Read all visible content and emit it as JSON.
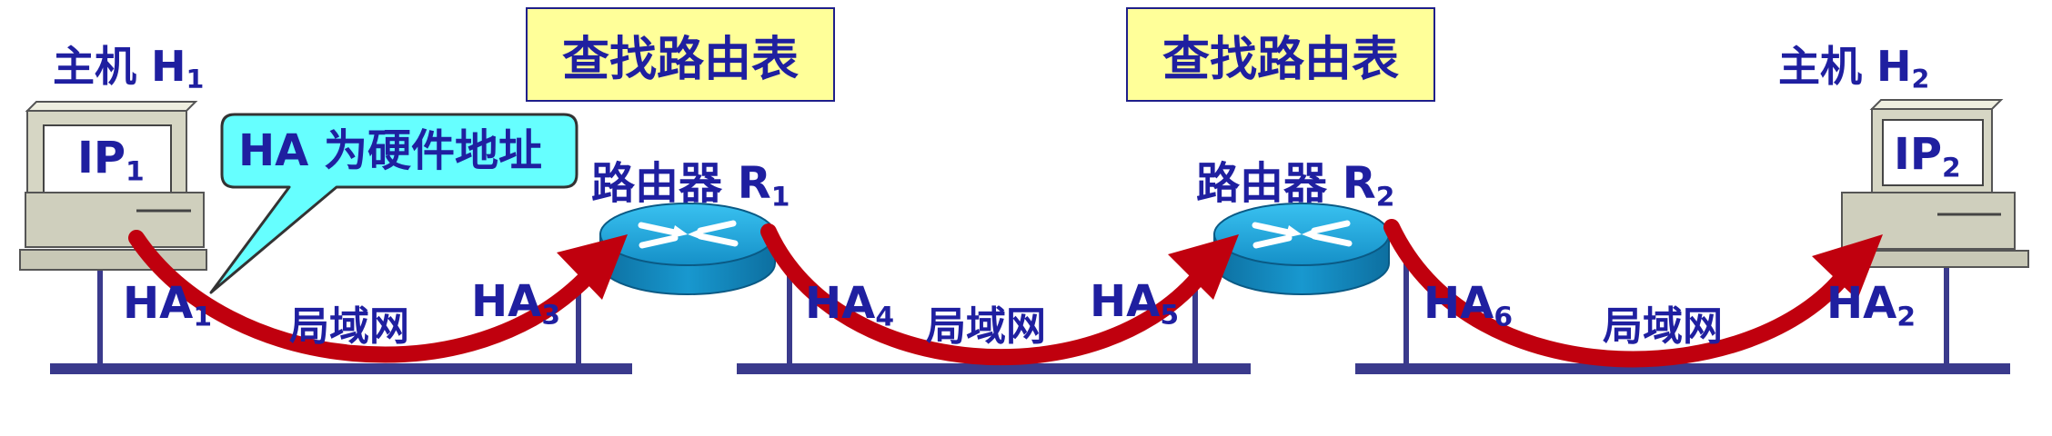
{
  "lookup_boxes": [
    {
      "label": "查找路由表"
    },
    {
      "label": "查找路由表"
    }
  ],
  "hosts": [
    {
      "label": "主机 H",
      "sub": "1",
      "screen_label": "IP",
      "screen_sub": "1"
    },
    {
      "label": "主机 H",
      "sub": "2",
      "screen_label": "IP",
      "screen_sub": "2"
    }
  ],
  "routers": [
    {
      "label": "路由器 R",
      "sub": "1"
    },
    {
      "label": "路由器 R",
      "sub": "2"
    }
  ],
  "callout": {
    "text": "HA 为硬件地址"
  },
  "lan_label": "局域网",
  "hardware_addresses": [
    {
      "label": "HA",
      "sub": "1"
    },
    {
      "label": "HA",
      "sub": "3"
    },
    {
      "label": "HA",
      "sub": "4"
    },
    {
      "label": "HA",
      "sub": "5"
    },
    {
      "label": "HA",
      "sub": "6"
    },
    {
      "label": "HA",
      "sub": "2"
    }
  ],
  "colors": {
    "text": "#1f1fa0",
    "box_fill": "#ffff99",
    "callout_fill": "#66ffff",
    "bus": "#3a3a8c",
    "arrow": "#c0000e",
    "router": "#1aa0d6",
    "computer": "#d4d4c0"
  }
}
